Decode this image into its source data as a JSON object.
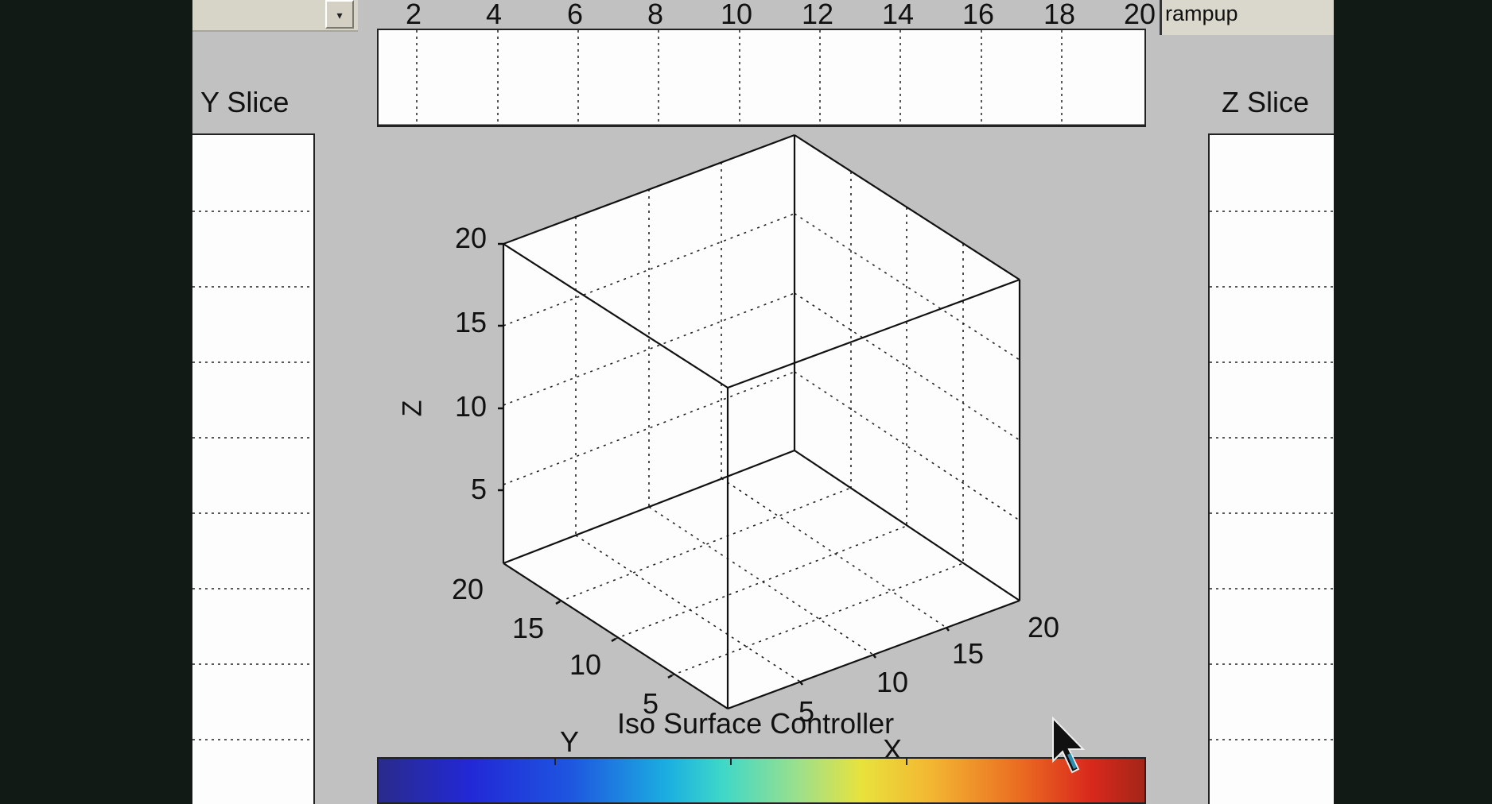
{
  "top_axis": {
    "ticks": [
      "2",
      "4",
      "6",
      "8",
      "10",
      "12",
      "14",
      "16",
      "18",
      "20"
    ]
  },
  "popup_menu": {
    "arrow": "▾"
  },
  "rampup_box": {
    "value": "rampup"
  },
  "y_slice": {
    "title": "Y Slice"
  },
  "z_slice": {
    "title": "Z Slice"
  },
  "cube_axes": {
    "z_label": "Z",
    "x_label": "X",
    "y_label": "Y",
    "z_ticks": [
      "20",
      "15",
      "10",
      "5"
    ],
    "y_ticks": [
      "20",
      "15",
      "10",
      "5"
    ],
    "x_ticks": [
      "5",
      "10",
      "15",
      "20"
    ]
  },
  "iso_surface": {
    "title": "Iso Surface Controller"
  },
  "colors": {
    "background": "#c1c1c1",
    "panel": "#fdfdfd",
    "letterbox": "#111a15"
  }
}
